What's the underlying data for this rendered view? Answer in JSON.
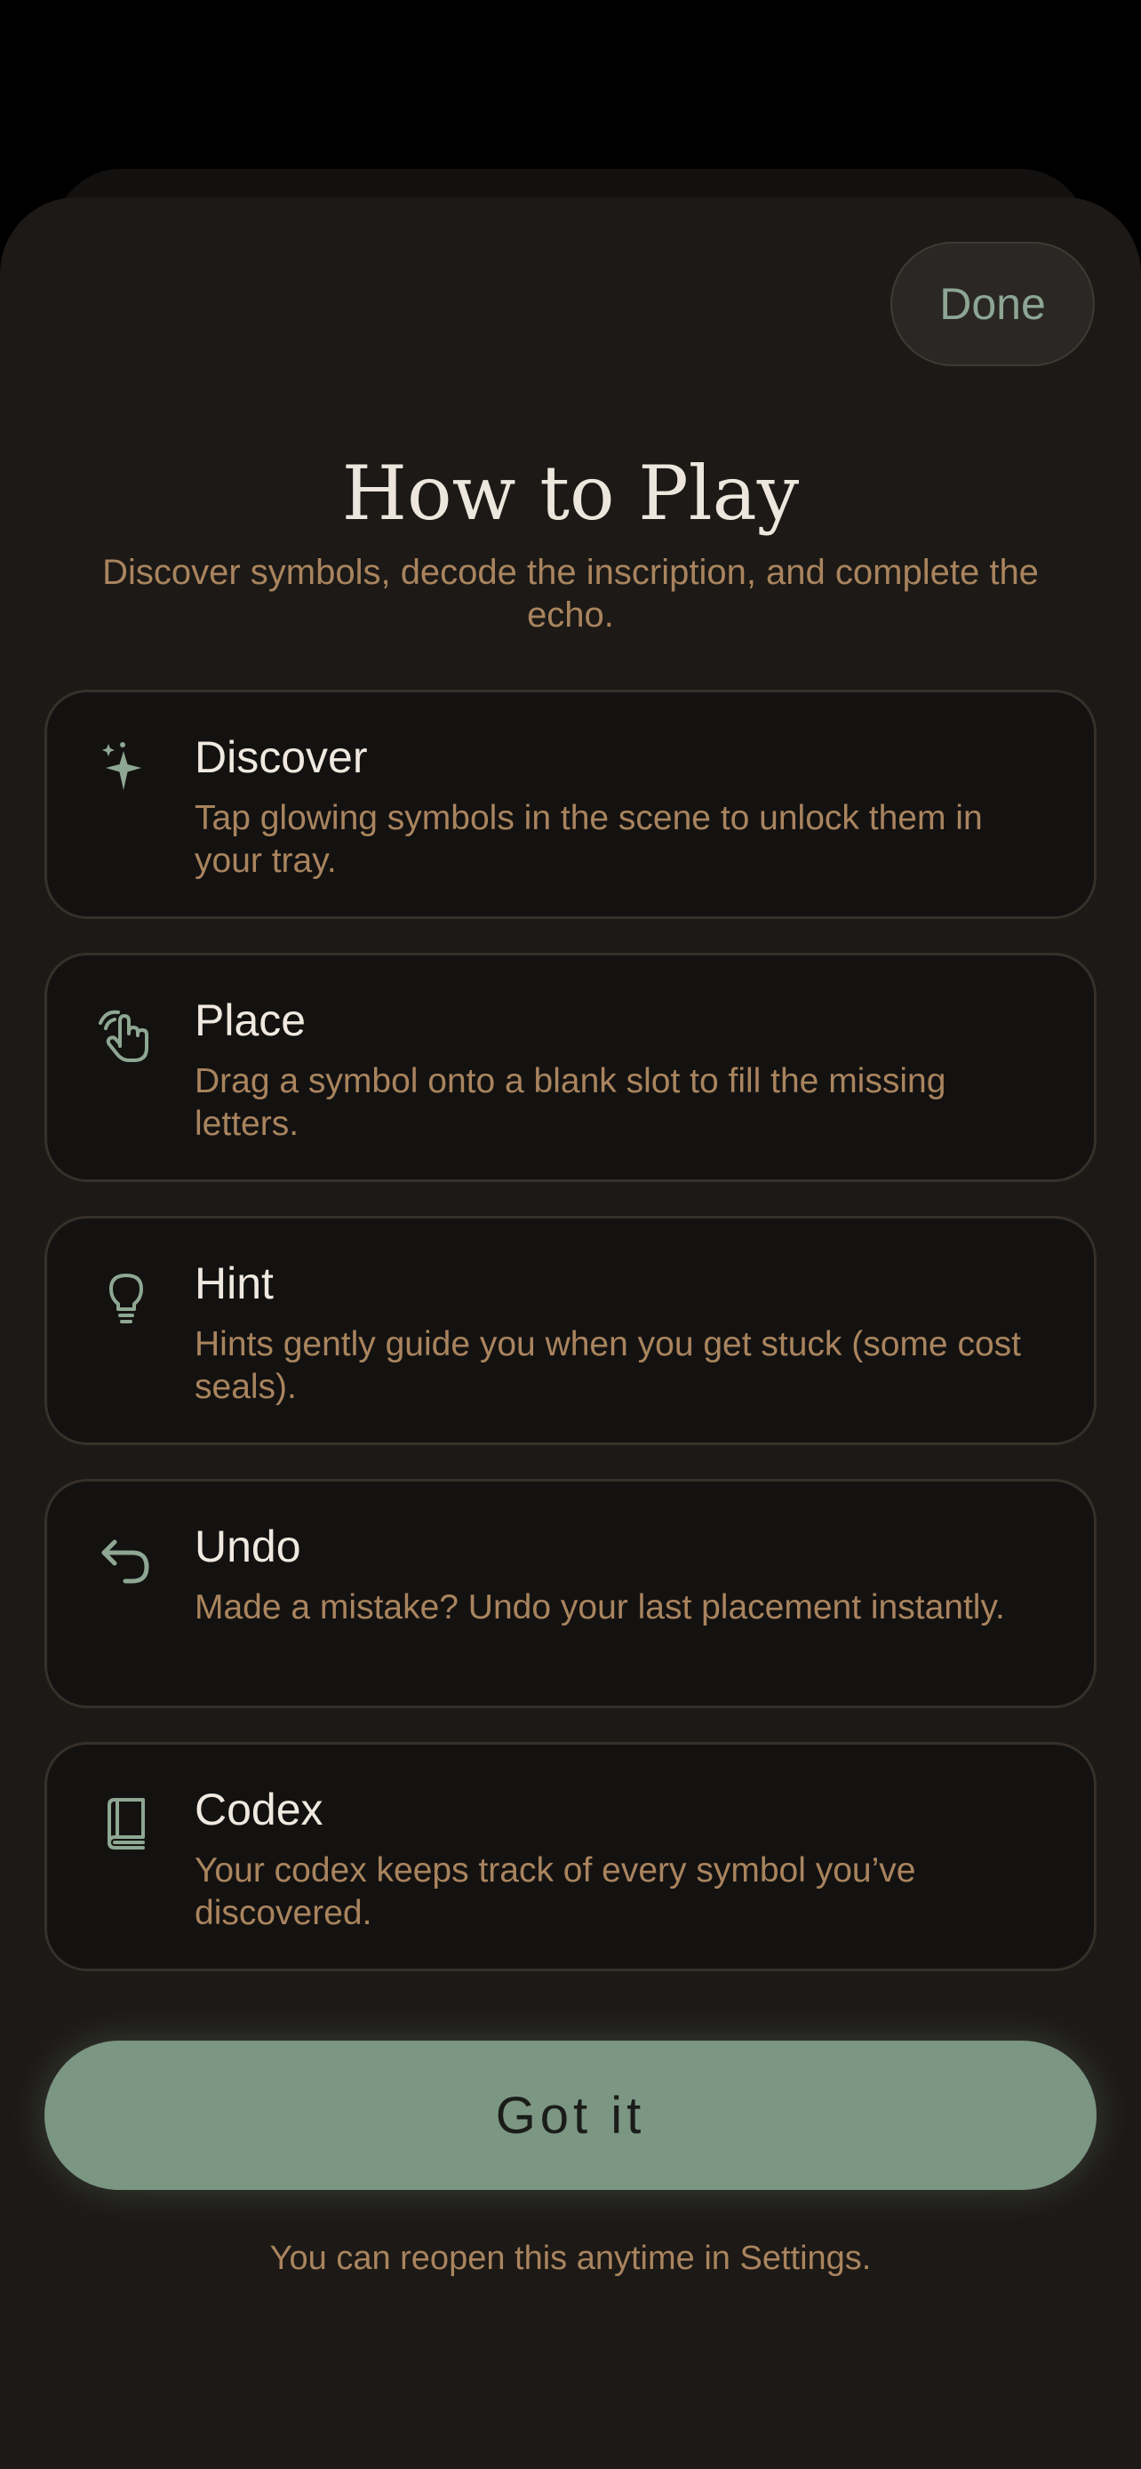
{
  "header": {
    "done_label": "Done"
  },
  "title": "How to Play",
  "subtitle": "Discover symbols, decode the inscription, and complete the echo.",
  "items": [
    {
      "icon": "sparkles-icon",
      "title": "Discover",
      "description": "Tap glowing symbols in the scene to unlock them in your tray."
    },
    {
      "icon": "hand-tap-icon",
      "title": "Place",
      "description": "Drag a symbol onto a blank slot to fill the missing letters."
    },
    {
      "icon": "lightbulb-icon",
      "title": "Hint",
      "description": "Hints gently guide you when you get stuck (some cost seals)."
    },
    {
      "icon": "undo-arrow-icon",
      "title": "Undo",
      "description": "Made a mistake? Undo your last placement instantly."
    },
    {
      "icon": "book-icon",
      "title": "Codex",
      "description": "Your codex keeps track of every symbol you’ve discovered."
    }
  ],
  "primary_button": {
    "label": "Got it"
  },
  "footer_note": "You can reopen this anytime in Settings.",
  "colors": {
    "background": "#1c1916",
    "card": "#141211",
    "accent": "#7b9683",
    "muted_text": "#a9845e",
    "icon": "#8ea793"
  }
}
